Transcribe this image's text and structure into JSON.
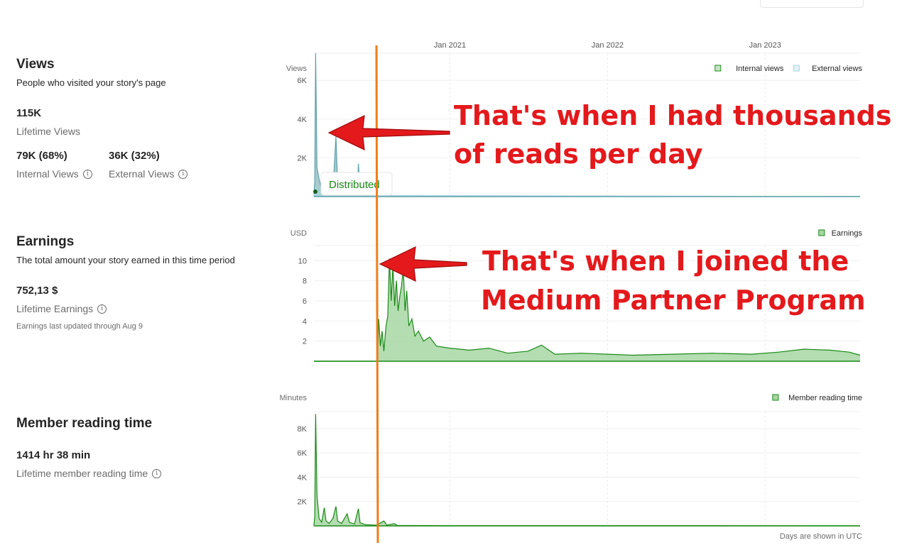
{
  "views": {
    "title": "Views",
    "subtitle": "People who visited your story's page",
    "lifetime_value": "115K",
    "lifetime_label": "Lifetime Views",
    "internal_value": "79K (68%)",
    "internal_label": "Internal Views",
    "external_value": "36K (32%)",
    "external_label": "External Views"
  },
  "earnings": {
    "title": "Earnings",
    "subtitle": "The total amount your story earned in this time period",
    "lifetime_value": "752,13 $",
    "lifetime_label": "Lifetime Earnings",
    "note": "Earnings last updated through Aug 9"
  },
  "reading": {
    "title": "Member reading time",
    "lifetime_value": "1414 hr 38 min",
    "lifetime_label": "Lifetime member reading time"
  },
  "info_icon": "i",
  "annotations": {
    "views_callout_line1": "That's when I had thousands",
    "views_callout_line2": "of reads per day",
    "earnings_callout_line1": "That's when I joined the",
    "earnings_callout_line2": "Medium Partner Program",
    "distributed_label": "Distributed"
  },
  "footer_note": "Days are shown in UTC",
  "colors": {
    "internal_views": "#5ea0a8",
    "external_views": "#a6d6e3",
    "earnings_line": "#1a8917",
    "earnings_fill": "#a7d7a3",
    "annotation_red": "#e4191c",
    "marker_line": "#f07d19"
  },
  "chart_data": [
    {
      "type": "area",
      "name": "views",
      "ylabel": "Views",
      "x_ticks": [
        "Jan 2021",
        "Jan 2022",
        "Jan 2023"
      ],
      "y_ticks": [
        "2K",
        "4K",
        "6K"
      ],
      "ylim": [
        0,
        7400
      ],
      "legend": [
        "Internal views",
        "External views"
      ],
      "legend_position": "top-right",
      "grid": true,
      "x_range": [
        "2020-02-21",
        "2023-08-09"
      ],
      "series": [
        {
          "name": "Internal views",
          "points": [
            [
              "2020-02-21",
              0
            ],
            [
              "2020-02-23",
              800
            ],
            [
              "2020-02-25",
              7400
            ],
            [
              "2020-02-28",
              1500
            ],
            [
              "2020-03-04",
              900
            ],
            [
              "2020-03-10",
              400
            ],
            [
              "2020-03-20",
              250
            ],
            [
              "2020-04-05",
              250
            ],
            [
              "2020-04-12",
              3100
            ],
            [
              "2020-04-16",
              700
            ],
            [
              "2020-04-25",
              300
            ],
            [
              "2020-05-10",
              900
            ],
            [
              "2020-05-14",
              300
            ],
            [
              "2020-06-01",
              200
            ],
            [
              "2020-06-03",
              1700
            ],
            [
              "2020-06-07",
              300
            ],
            [
              "2020-06-20",
              100
            ],
            [
              "2020-07-20",
              80
            ],
            [
              "2020-08-01",
              350
            ],
            [
              "2020-08-08",
              80
            ],
            [
              "2020-09-01",
              30
            ],
            [
              "2021-01-01",
              20
            ],
            [
              "2022-01-01",
              10
            ],
            [
              "2023-08-09",
              5
            ]
          ]
        },
        {
          "name": "External views",
          "points": [
            [
              "2020-02-21",
              0
            ],
            [
              "2020-02-25",
              500
            ],
            [
              "2020-03-05",
              200
            ],
            [
              "2020-05-01",
              100
            ],
            [
              "2020-08-01",
              50
            ],
            [
              "2023-08-09",
              5
            ]
          ]
        }
      ]
    },
    {
      "type": "area",
      "name": "earnings",
      "ylabel": "USD",
      "x_ticks": [],
      "y_ticks": [
        "2",
        "4",
        "6",
        "8",
        "10"
      ],
      "ylim": [
        0,
        11.5
      ],
      "legend": [
        "Earnings"
      ],
      "legend_position": "top-right",
      "grid": true,
      "x_range": [
        "2020-02-21",
        "2023-08-09"
      ],
      "series": [
        {
          "name": "Earnings",
          "points": [
            [
              "2020-02-21",
              0
            ],
            [
              "2020-07-17",
              0
            ],
            [
              "2020-07-20",
              4.2
            ],
            [
              "2020-07-24",
              1.5
            ],
            [
              "2020-07-28",
              3.0
            ],
            [
              "2020-08-01",
              1.0
            ],
            [
              "2020-08-06",
              3.5
            ],
            [
              "2020-08-10",
              4.5
            ],
            [
              "2020-08-14",
              10.2
            ],
            [
              "2020-08-18",
              6.0
            ],
            [
              "2020-08-22",
              9.5
            ],
            [
              "2020-08-26",
              5.5
            ],
            [
              "2020-08-30",
              8.0
            ],
            [
              "2020-09-03",
              5.0
            ],
            [
              "2020-09-07",
              6.5
            ],
            [
              "2020-09-11",
              7.5
            ],
            [
              "2020-09-15",
              9.3
            ],
            [
              "2020-09-19",
              5.0
            ],
            [
              "2020-09-23",
              7.0
            ],
            [
              "2020-09-28",
              3.5
            ],
            [
              "2020-10-05",
              4.2
            ],
            [
              "2020-10-12",
              2.5
            ],
            [
              "2020-10-20",
              3.0
            ],
            [
              "2020-11-01",
              2.0
            ],
            [
              "2020-11-15",
              2.4
            ],
            [
              "2020-12-01",
              1.5
            ],
            [
              "2021-01-01",
              1.3
            ],
            [
              "2021-02-15",
              1.1
            ],
            [
              "2021-04-01",
              1.3
            ],
            [
              "2021-05-15",
              0.8
            ],
            [
              "2021-07-01",
              1.0
            ],
            [
              "2021-08-01",
              1.6
            ],
            [
              "2021-09-01",
              0.7
            ],
            [
              "2021-11-01",
              0.8
            ],
            [
              "2022-01-01",
              0.7
            ],
            [
              "2022-03-01",
              0.6
            ],
            [
              "2022-06-01",
              0.7
            ],
            [
              "2022-09-01",
              0.8
            ],
            [
              "2022-12-01",
              0.7
            ],
            [
              "2023-02-01",
              0.9
            ],
            [
              "2023-04-01",
              1.2
            ],
            [
              "2023-06-01",
              1.1
            ],
            [
              "2023-07-15",
              0.9
            ],
            [
              "2023-08-09",
              0.6
            ]
          ]
        }
      ]
    },
    {
      "type": "area",
      "name": "member_reading_time",
      "ylabel": "Minutes",
      "x_ticks": [],
      "y_ticks": [
        "2K",
        "4K",
        "6K",
        "8K"
      ],
      "ylim": [
        0,
        9400
      ],
      "legend": [
        "Member reading time"
      ],
      "legend_position": "top-right",
      "grid": true,
      "x_range": [
        "2020-02-21",
        "2023-08-09"
      ],
      "series": [
        {
          "name": "Member reading time",
          "points": [
            [
              "2020-02-21",
              0
            ],
            [
              "2020-02-23",
              800
            ],
            [
              "2020-02-25",
              9200
            ],
            [
              "2020-02-28",
              2500
            ],
            [
              "2020-03-04",
              600
            ],
            [
              "2020-03-10",
              300
            ],
            [
              "2020-03-16",
              1500
            ],
            [
              "2020-03-20",
              400
            ],
            [
              "2020-03-27",
              200
            ],
            [
              "2020-04-05",
              600
            ],
            [
              "2020-04-12",
              1600
            ],
            [
              "2020-04-16",
              400
            ],
            [
              "2020-04-25",
              200
            ],
            [
              "2020-05-08",
              1000
            ],
            [
              "2020-05-13",
              300
            ],
            [
              "2020-05-25",
              150
            ],
            [
              "2020-06-03",
              1400
            ],
            [
              "2020-06-07",
              250
            ],
            [
              "2020-06-20",
              100
            ],
            [
              "2020-07-15",
              60
            ],
            [
              "2020-08-01",
              400
            ],
            [
              "2020-08-08",
              60
            ],
            [
              "2020-08-25",
              180
            ],
            [
              "2020-09-01",
              40
            ],
            [
              "2021-01-01",
              20
            ],
            [
              "2023-08-09",
              10
            ]
          ]
        }
      ]
    }
  ]
}
